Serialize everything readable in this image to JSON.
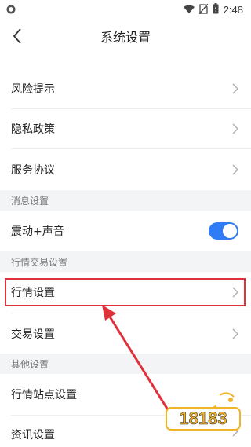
{
  "status_bar": {
    "time": "2:48",
    "icons": [
      "shield-icon",
      "wifi-icon",
      "no-sim-icon",
      "battery-charging-icon"
    ]
  },
  "header": {
    "title": "系统设置",
    "back_icon": "chevron-left-icon"
  },
  "items": {
    "risk": "风险提示",
    "privacy": "隐私政策",
    "service": "服务协议",
    "vibration": "震动+声音",
    "quote_settings": "行情设置",
    "trade_settings": "交易设置",
    "quote_sites": "行情站点设置",
    "news_settings": "资讯设置"
  },
  "sections": {
    "message": "消息设置",
    "quote_trade": "行情交易设置",
    "other": "其他设置"
  },
  "toggles": {
    "vibration_on": true
  },
  "watermark": {
    "text": "18183"
  },
  "colors": {
    "accent": "#2f7cf6",
    "highlight": "#e0313b",
    "section_bg": "#f3f4f6"
  }
}
